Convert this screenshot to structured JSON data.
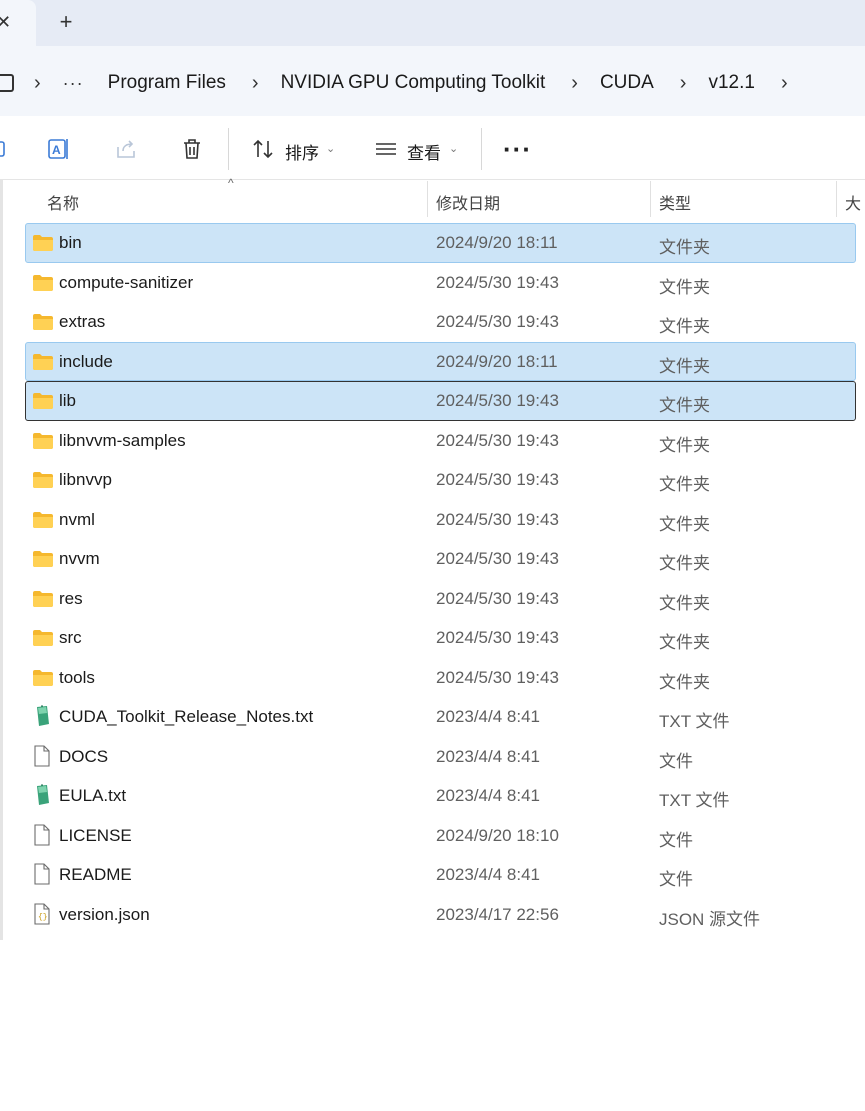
{
  "tabs": {
    "close_glyph": "✕",
    "new_tab_glyph": "+"
  },
  "breadcrumb": {
    "overflow": "···",
    "items": [
      "Program Files",
      "NVIDIA GPU Computing Toolkit",
      "CUDA",
      "v12.1"
    ]
  },
  "toolbar": {
    "sort_label": "排序",
    "view_label": "查看",
    "more_label": "···"
  },
  "columns": {
    "name": "名称",
    "modified": "修改日期",
    "type": "类型",
    "size": "大"
  },
  "files": [
    {
      "name": "bin",
      "modified": "2024/9/20 18:11",
      "type": "文件夹",
      "icon": "folder-icon",
      "state": "selected"
    },
    {
      "name": "compute-sanitizer",
      "modified": "2024/5/30 19:43",
      "type": "文件夹",
      "icon": "folder-icon",
      "state": ""
    },
    {
      "name": "extras",
      "modified": "2024/5/30 19:43",
      "type": "文件夹",
      "icon": "folder-icon",
      "state": ""
    },
    {
      "name": "include",
      "modified": "2024/9/20 18:11",
      "type": "文件夹",
      "icon": "folder-icon",
      "state": "selected"
    },
    {
      "name": "lib",
      "modified": "2024/5/30 19:43",
      "type": "文件夹",
      "icon": "folder-icon",
      "state": "focused"
    },
    {
      "name": "libnvvm-samples",
      "modified": "2024/5/30 19:43",
      "type": "文件夹",
      "icon": "folder-icon",
      "state": ""
    },
    {
      "name": "libnvvp",
      "modified": "2024/5/30 19:43",
      "type": "文件夹",
      "icon": "folder-icon",
      "state": ""
    },
    {
      "name": "nvml",
      "modified": "2024/5/30 19:43",
      "type": "文件夹",
      "icon": "folder-icon",
      "state": ""
    },
    {
      "name": "nvvm",
      "modified": "2024/5/30 19:43",
      "type": "文件夹",
      "icon": "folder-icon",
      "state": ""
    },
    {
      "name": "res",
      "modified": "2024/5/30 19:43",
      "type": "文件夹",
      "icon": "folder-icon",
      "state": ""
    },
    {
      "name": "src",
      "modified": "2024/5/30 19:43",
      "type": "文件夹",
      "icon": "folder-icon",
      "state": ""
    },
    {
      "name": "tools",
      "modified": "2024/5/30 19:43",
      "type": "文件夹",
      "icon": "folder-icon",
      "state": ""
    },
    {
      "name": "CUDA_Toolkit_Release_Notes.txt",
      "modified": "2023/4/4 8:41",
      "type": "TXT 文件",
      "icon": "notepad-icon",
      "state": ""
    },
    {
      "name": "DOCS",
      "modified": "2023/4/4 8:41",
      "type": "文件",
      "icon": "file-icon",
      "state": ""
    },
    {
      "name": "EULA.txt",
      "modified": "2023/4/4 8:41",
      "type": "TXT 文件",
      "icon": "notepad-icon",
      "state": ""
    },
    {
      "name": "LICENSE",
      "modified": "2024/9/20 18:10",
      "type": "文件",
      "icon": "file-icon",
      "state": ""
    },
    {
      "name": "README",
      "modified": "2023/4/4 8:41",
      "type": "文件",
      "icon": "file-icon",
      "state": ""
    },
    {
      "name": "version.json",
      "modified": "2023/4/17 22:56",
      "type": "JSON 源文件",
      "icon": "json-icon",
      "state": ""
    }
  ],
  "colors": {
    "selection_bg": "#cce4f7",
    "selection_border": "#99c9ef",
    "folder": "#f7c948"
  }
}
